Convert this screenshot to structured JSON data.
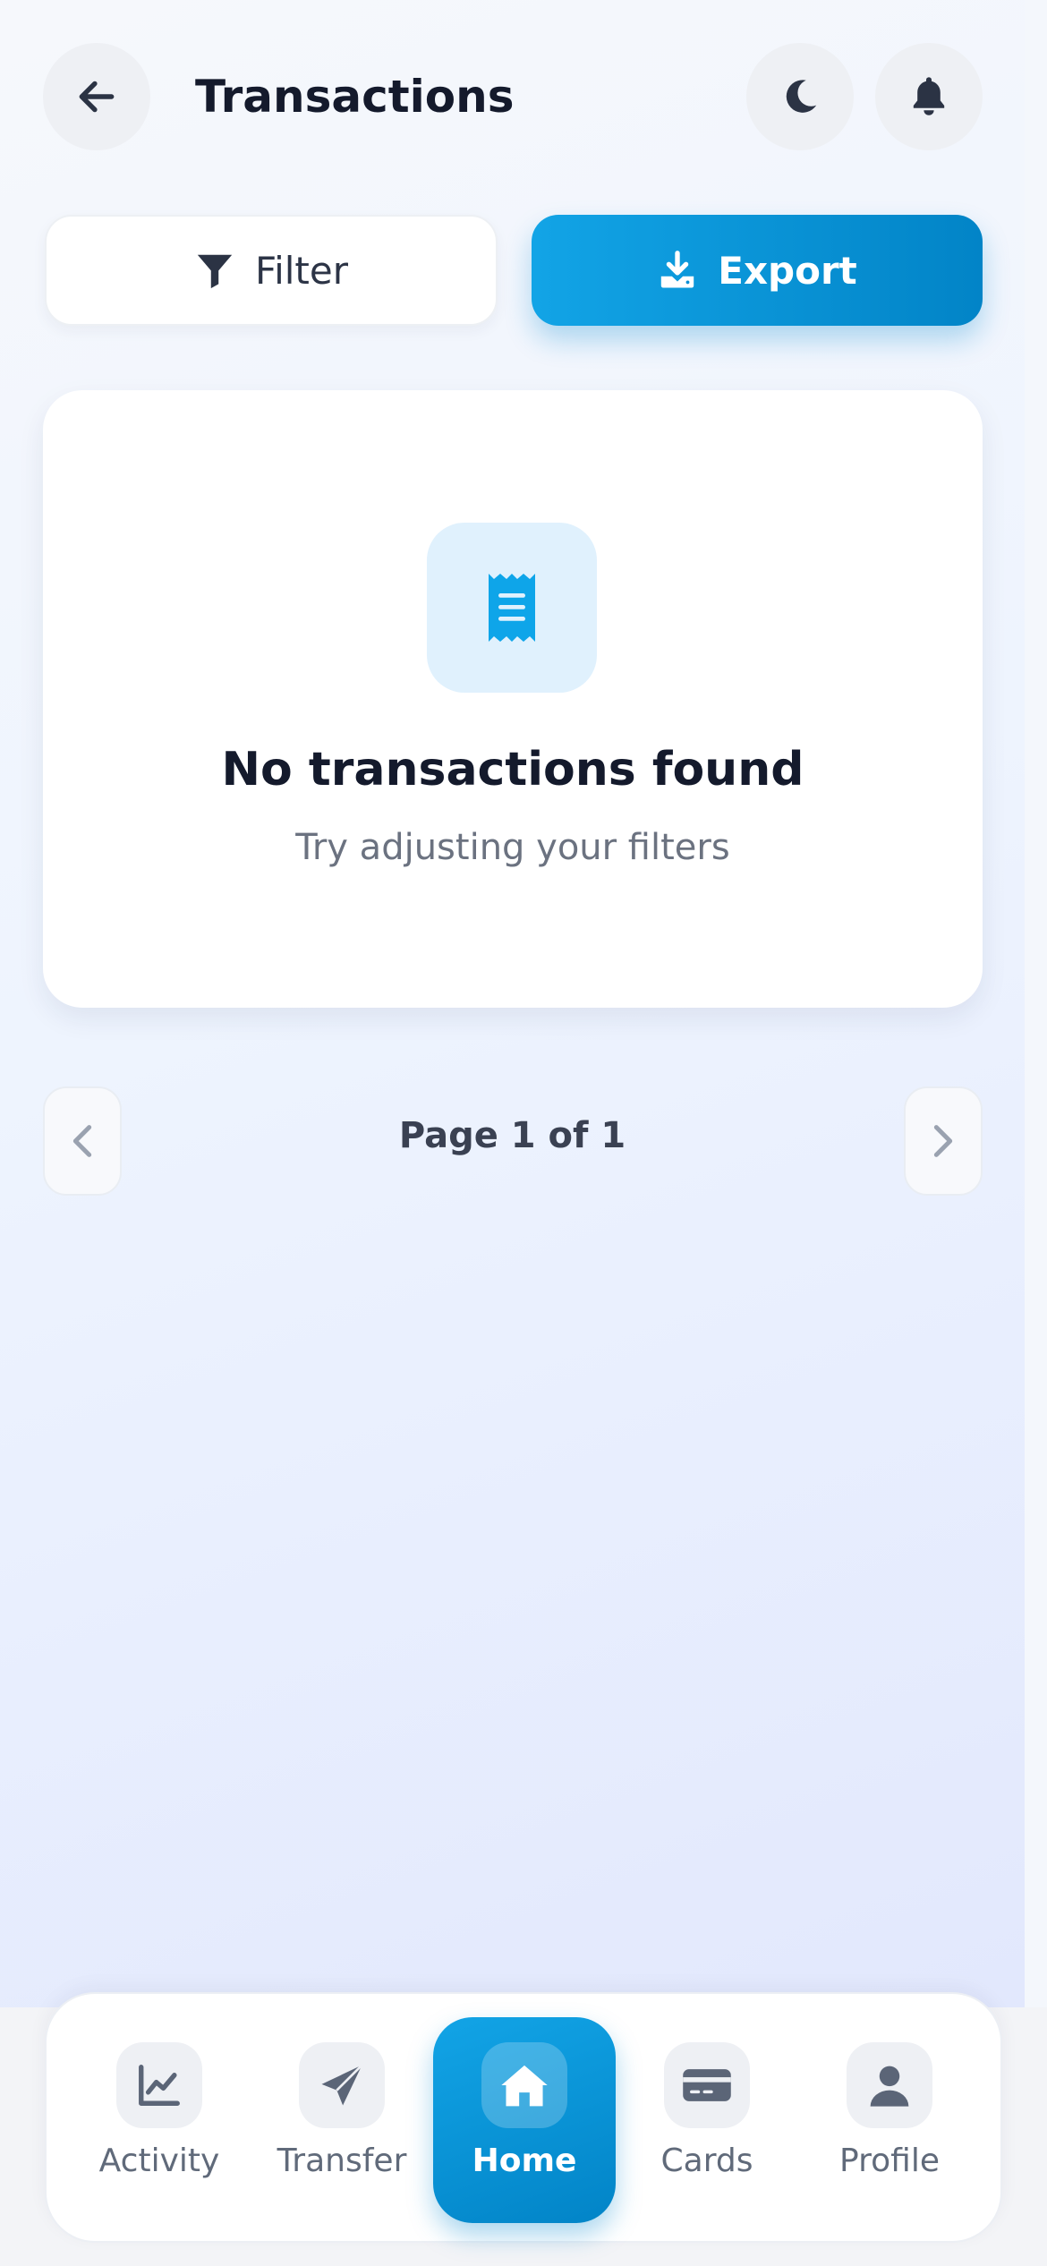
{
  "header": {
    "title": "Transactions",
    "back_icon": "arrow-left-icon",
    "theme_icon": "moon-icon",
    "notification_icon": "bell-icon"
  },
  "actions": {
    "filter_label": "Filter",
    "filter_icon": "funnel-icon",
    "export_label": "Export",
    "export_icon": "download-icon"
  },
  "empty_state": {
    "icon": "receipt-icon",
    "title": "No transactions found",
    "subtitle": "Try adjusting your filters"
  },
  "pagination": {
    "label": "Page 1 of 1",
    "current_page": 1,
    "total_pages": 1
  },
  "bottom_nav": {
    "items": [
      {
        "label": "Activity",
        "icon": "chart-line-icon",
        "active": false
      },
      {
        "label": "Transfer",
        "icon": "paper-plane-icon",
        "active": false
      },
      {
        "label": "Home",
        "icon": "home-icon",
        "active": true
      },
      {
        "label": "Cards",
        "icon": "credit-card-icon",
        "active": false
      },
      {
        "label": "Profile",
        "icon": "user-icon",
        "active": false
      }
    ]
  },
  "colors": {
    "accent": "#0ea5e9",
    "accent_dark": "#0284c7",
    "text_primary": "#141a2c",
    "text_secondary": "#6b7280"
  }
}
